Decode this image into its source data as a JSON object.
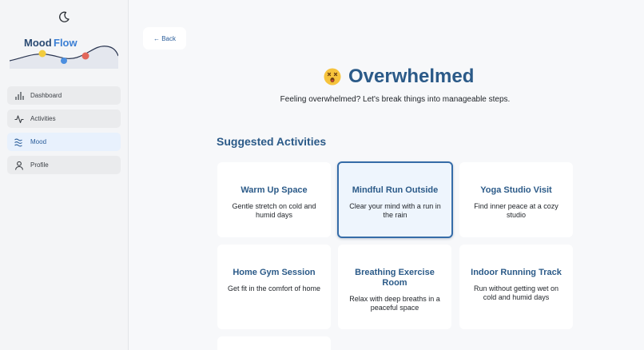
{
  "sidebar": {
    "logo": {
      "word1": "Mood",
      "word2": "Flow"
    },
    "nav": [
      {
        "label": "Dashboard",
        "icon": "bar-chart-icon"
      },
      {
        "label": "Activities",
        "icon": "activity-pulse-icon"
      },
      {
        "label": "Mood",
        "icon": "waves-icon",
        "active": true
      },
      {
        "label": "Profile",
        "icon": "user-icon"
      }
    ]
  },
  "main": {
    "back_label": "← Back",
    "mood_title": "Overwhelmed",
    "mood_emoji": "dizzy-face",
    "subtitle": "Feeling overwhelmed? Let's break things into manageable steps.",
    "section_title": "Suggested Activities",
    "activities": [
      {
        "title": "Warm Up Space",
        "desc": "Gentle stretch on cold and humid days"
      },
      {
        "title": "Mindful Run Outside",
        "desc": "Clear your mind with a run in the rain",
        "selected": true
      },
      {
        "title": "Yoga Studio Visit",
        "desc": "Find inner peace at a cozy studio"
      },
      {
        "title": "Home Gym Session",
        "desc": "Get fit in the comfort of home"
      },
      {
        "title": "Breathing Exercise Room",
        "desc": "Relax with deep breaths in a peaceful space"
      },
      {
        "title": "Indoor Running Track",
        "desc": "Run without getting wet on cold and humid days"
      }
    ]
  },
  "colors": {
    "accent": "#2b5a88",
    "selected_border": "#356ca8",
    "active_nav_bg": "#e8f1fd"
  }
}
